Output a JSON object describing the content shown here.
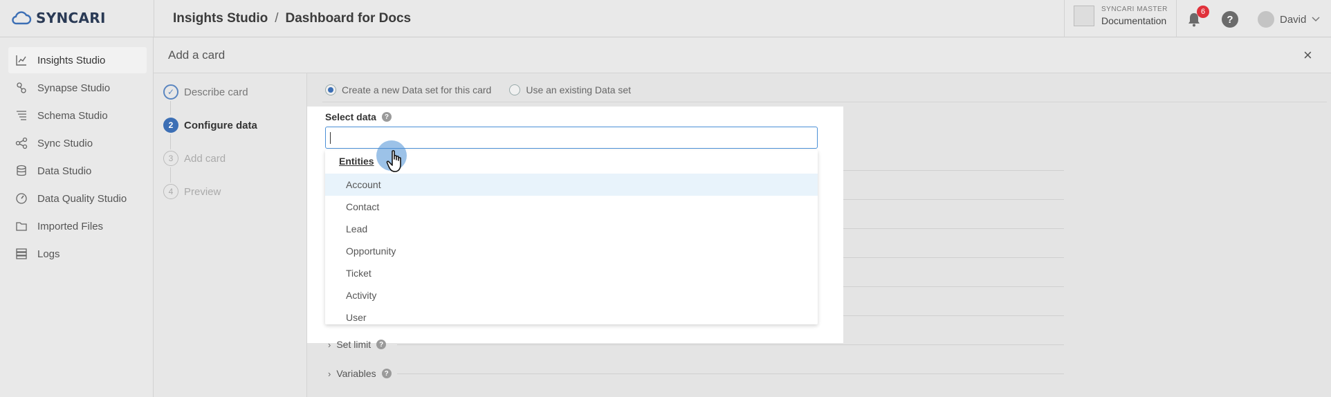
{
  "app": {
    "logo_text": "SYNCARI",
    "breadcrumb": [
      "Insights Studio",
      "Dashboard for Docs"
    ],
    "breadcrumb_separator": "/"
  },
  "account": {
    "label": "SYNCARI MASTER",
    "name": "Documentation"
  },
  "notifications": {
    "count": "6",
    "icon": "bell-icon"
  },
  "help": {
    "label": "?"
  },
  "user": {
    "name": "David"
  },
  "sidebar": {
    "items": [
      {
        "label": "Insights Studio",
        "icon": "chart-icon",
        "active": true
      },
      {
        "label": "Synapse Studio",
        "icon": "synapse-icon",
        "active": false
      },
      {
        "label": "Schema Studio",
        "icon": "schema-icon",
        "active": false
      },
      {
        "label": "Sync Studio",
        "icon": "sync-icon",
        "active": false
      },
      {
        "label": "Data Studio",
        "icon": "database-icon",
        "active": false
      },
      {
        "label": "Data Quality Studio",
        "icon": "gauge-icon",
        "active": false
      },
      {
        "label": "Imported Files",
        "icon": "folder-icon",
        "active": false
      },
      {
        "label": "Logs",
        "icon": "logs-icon",
        "active": false
      }
    ]
  },
  "panel": {
    "title": "Add a card",
    "close_label": "×"
  },
  "steps": [
    {
      "label": "Describe card",
      "state": "done",
      "marker": "✓"
    },
    {
      "label": "Configure data",
      "state": "current",
      "marker": "2"
    },
    {
      "label": "Add card",
      "state": "pending",
      "marker": "3"
    },
    {
      "label": "Preview",
      "state": "pending",
      "marker": "4"
    }
  ],
  "data_source": {
    "options": [
      {
        "label": "Create a new Data set for this card",
        "selected": true
      },
      {
        "label": "Use an existing Data set",
        "selected": false
      }
    ]
  },
  "select_data": {
    "label": "Select data",
    "help": "?",
    "value": "",
    "placeholder": ""
  },
  "dropdown": {
    "heading": "Entities",
    "items": [
      "Account",
      "Contact",
      "Lead",
      "Opportunity",
      "Ticket",
      "Activity",
      "User"
    ],
    "highlighted": "Account"
  },
  "sections": [
    {
      "label": "Set limit",
      "help": "?"
    },
    {
      "label": "Variables",
      "help": "?"
    }
  ],
  "colors": {
    "accent": "#3c6fb5",
    "focus_border": "#4a8fd6",
    "highlight_row": "#e8f3fb",
    "badge": "#e0313b"
  }
}
